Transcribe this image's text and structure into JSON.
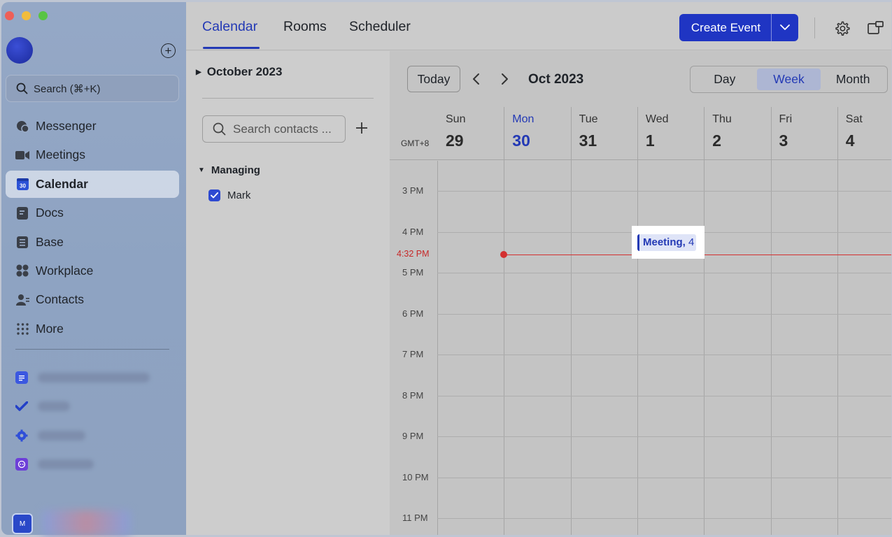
{
  "window": {
    "traffic_lights": [
      "close",
      "minimize",
      "maximize"
    ]
  },
  "sidebar": {
    "search_label": "Search (⌘+K)",
    "items": [
      {
        "label": "Messenger",
        "icon": "messenger-icon",
        "active": false
      },
      {
        "label": "Meetings",
        "icon": "video-camera-icon",
        "active": false
      },
      {
        "label": "Calendar",
        "icon": "calendar-icon",
        "active": true
      },
      {
        "label": "Docs",
        "icon": "docs-icon",
        "active": false
      },
      {
        "label": "Base",
        "icon": "base-icon",
        "active": false
      },
      {
        "label": "Workplace",
        "icon": "workplace-icon",
        "active": false
      },
      {
        "label": "Contacts",
        "icon": "contacts-icon",
        "active": false
      },
      {
        "label": "More",
        "icon": "more-grid-icon",
        "active": false
      }
    ],
    "calendar_icon_text": "30",
    "pinned_icons": [
      "doc-pin-icon",
      "task-check-icon",
      "settings-pin-icon",
      "chat-bot-icon"
    ],
    "bottom_avatar_text": "M"
  },
  "topbar": {
    "tabs": [
      "Calendar",
      "Rooms",
      "Scheduler"
    ],
    "active_tab": "Calendar",
    "create_event_label": "Create Event"
  },
  "panel": {
    "month_label": "October 2023",
    "contact_search_placeholder": "Search contacts ...",
    "group_label": "Managing",
    "members": [
      {
        "name": "Mark",
        "checked": true
      }
    ]
  },
  "calendar": {
    "today_label": "Today",
    "title": "Oct 2023",
    "views": [
      "Day",
      "Week",
      "Month"
    ],
    "active_view": "Week",
    "timezone": "GMT+8",
    "days": [
      {
        "dow": "Sun",
        "date": "29"
      },
      {
        "dow": "Mon",
        "date": "30",
        "today": true
      },
      {
        "dow": "Tue",
        "date": "31"
      },
      {
        "dow": "Wed",
        "date": "1"
      },
      {
        "dow": "Thu",
        "date": "2"
      },
      {
        "dow": "Fri",
        "date": "3"
      },
      {
        "dow": "Sat",
        "date": "4"
      }
    ],
    "hours": [
      "3 PM",
      "4 PM",
      "5 PM",
      "6 PM",
      "7 PM",
      "8 PM",
      "9 PM",
      "10 PM",
      "11 PM"
    ],
    "now_label": "4:32 PM",
    "event": {
      "title": "Meeting,",
      "suffix": "4",
      "day": "Wed"
    }
  },
  "colors": {
    "accent": "#2339b5",
    "button": "#1f35c3",
    "now": "#d32f2f"
  }
}
